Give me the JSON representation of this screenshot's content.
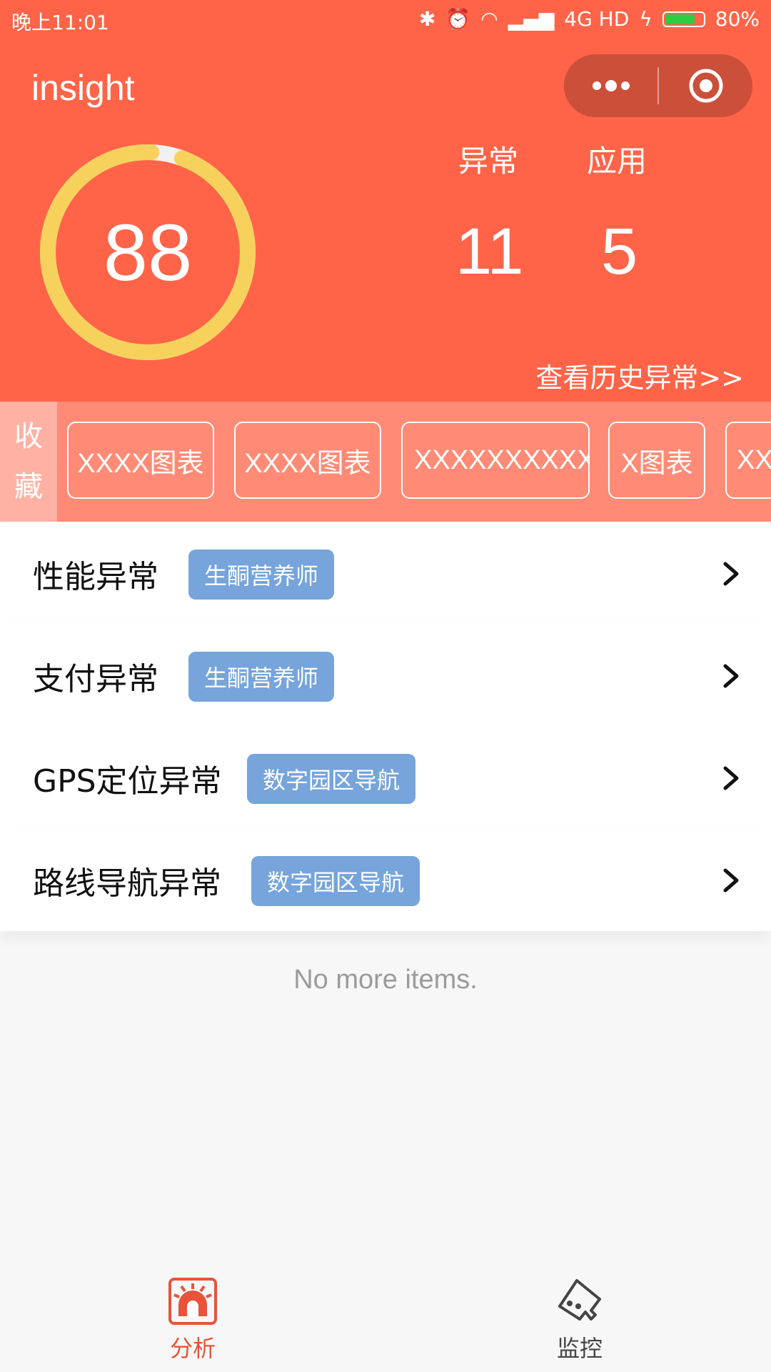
{
  "status_bar": {
    "time": "晚上11:01",
    "network": "4G HD",
    "battery_label": "80%",
    "battery_level": 0.8
  },
  "header": {
    "title": "insight",
    "score": "88",
    "score_ring_fraction": 0.95,
    "stats": [
      {
        "label": "异常",
        "value": "11"
      },
      {
        "label": "应用",
        "value": "5"
      }
    ],
    "history_link": "查看历史异常>>",
    "colors": {
      "background": "#ff6448",
      "ring": "#f6d25d",
      "ring_track": "#f1f1f1"
    }
  },
  "favorites": {
    "label_top": "收",
    "label_bottom": "藏",
    "chips": [
      "XXXX图表",
      "XXXX图表",
      "XXXXXXXXXX",
      "X图表",
      "XX"
    ]
  },
  "list": [
    {
      "title": "性能异常",
      "tag": "生酮营养师"
    },
    {
      "title": "支付异常",
      "tag": "生酮营养师"
    },
    {
      "title": "GPS定位异常",
      "tag": "数字园区导航"
    },
    {
      "title": "路线导航异常",
      "tag": "数字园区导航"
    }
  ],
  "no_more_text": "No more items.",
  "tabbar": {
    "items": [
      {
        "label": "分析",
        "icon": "alarm-siren-icon",
        "active": true
      },
      {
        "label": "监控",
        "icon": "monitor-tag-icon",
        "active": false
      }
    ],
    "active_color": "#e8533a",
    "inactive_color": "#444444"
  }
}
